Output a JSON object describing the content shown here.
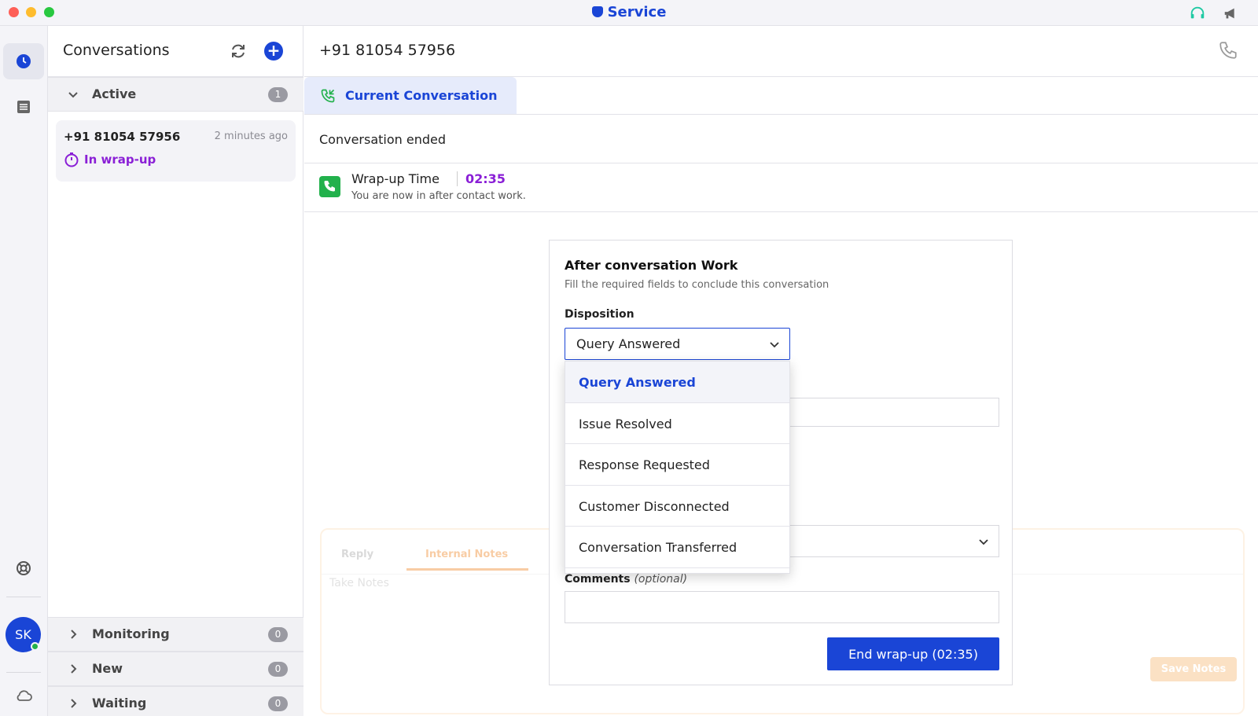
{
  "app": {
    "title": "Service"
  },
  "rail": {
    "avatar_initials": "SK"
  },
  "conversations": {
    "title": "Conversations",
    "sections": [
      {
        "label": "Active",
        "count": "1"
      },
      {
        "label": "Monitoring",
        "count": "0"
      },
      {
        "label": "New",
        "count": "0"
      },
      {
        "label": "Waiting",
        "count": "0"
      }
    ],
    "active_item": {
      "number": "+91 81054 57956",
      "time": "2 minutes ago",
      "status": "In wrap-up"
    }
  },
  "main": {
    "phone_number": "+91 81054 57956",
    "tab_label": "Current Conversation",
    "status_text": "Conversation ended",
    "wrapup": {
      "title": "Wrap-up Time",
      "time": "02:35",
      "subtitle": "You are now in after contact work."
    }
  },
  "composer": {
    "reply_tab": "Reply",
    "notes_tab": "Internal Notes",
    "placeholder": "Take Notes",
    "save_label": "Save Notes"
  },
  "card": {
    "title": "After conversation Work",
    "subtitle": "Fill the required fields to conclude this conversation",
    "disposition_label": "Disposition",
    "disposition_value": "Query Answered",
    "comments_label": "Comments",
    "comments_optional": "(optional)",
    "end_button": "End wrap-up (02:35)"
  },
  "dropdown": {
    "options": [
      "Query Answered",
      "Issue Resolved",
      "Response Requested",
      "Customer Disconnected",
      "Conversation Transferred"
    ],
    "selected": "Query Answered"
  },
  "colors": {
    "accent": "#1a45d6",
    "wrapup": "#8a1fd6",
    "success": "#22b14c",
    "notes": "#f3a45a"
  }
}
